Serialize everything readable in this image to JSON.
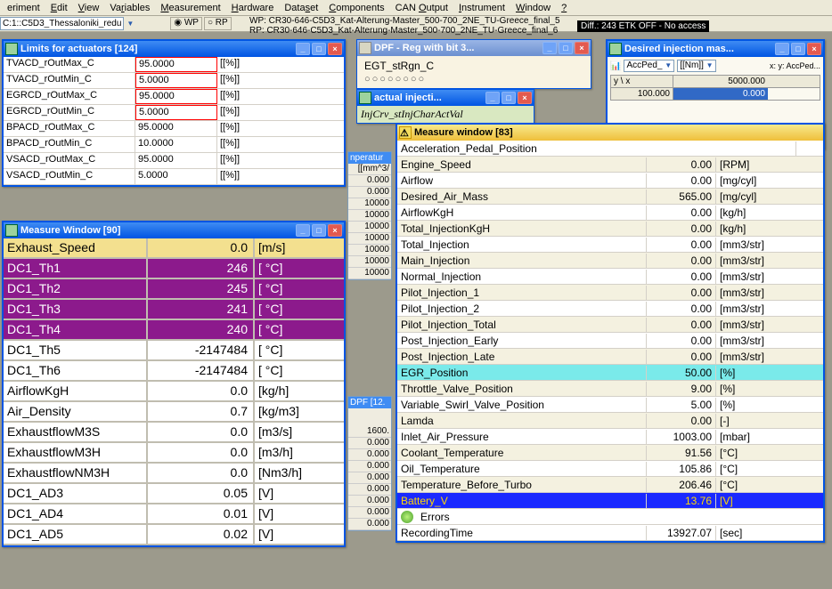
{
  "menu": {
    "items": [
      {
        "l": "eriment",
        "u": ""
      },
      {
        "l": "Edit",
        "u": "E"
      },
      {
        "l": "View",
        "u": "V"
      },
      {
        "l": "Variables",
        "u": "r"
      },
      {
        "l": "Measurement",
        "u": "M"
      },
      {
        "l": "Hardware",
        "u": "H"
      },
      {
        "l": "Dataset",
        "u": "s"
      },
      {
        "l": "Components",
        "u": "C"
      },
      {
        "l": "CAN Output",
        "u": "O"
      },
      {
        "l": "Instrument",
        "u": "I"
      },
      {
        "l": "Window",
        "u": "W"
      },
      {
        "l": "?",
        "u": "?"
      }
    ]
  },
  "tool": {
    "combo": "C:1::C5D3_Thessaloniki_redu",
    "wp": "WP",
    "rp": "RP",
    "wp_line": "WP: CR30-646-C5D3_Kat-Alterung-Master_500-700_2NE_TU-Greece_final_5",
    "rp_line": "RP: CR30-646-C5D3_Kat-Alterung-Master_500-700_2NE_TU-Greece_final_6",
    "diff": "Diff.: 243  ETK OFF - No access"
  },
  "limits": {
    "title": "Limits for actuators [124]",
    "rows": [
      {
        "n": "TVACD_rOutMax_C",
        "v": "95.0000",
        "u": "[[%]]",
        "r": true
      },
      {
        "n": "TVACD_rOutMin_C",
        "v": "5.0000",
        "u": "[[%]]",
        "r": true
      },
      {
        "n": "EGRCD_rOutMax_C",
        "v": "95.0000",
        "u": "[[%]]",
        "r": true
      },
      {
        "n": "EGRCD_rOutMin_C",
        "v": "5.0000",
        "u": "[[%]]",
        "r": true
      },
      {
        "n": "BPACD_rOutMax_C",
        "v": "95.0000",
        "u": "[[%]]",
        "r": false
      },
      {
        "n": "BPACD_rOutMin_C",
        "v": "10.0000",
        "u": "[[%]]",
        "r": false
      },
      {
        "n": "VSACD_rOutMax_C",
        "v": "95.0000",
        "u": "[[%]]",
        "r": false
      },
      {
        "n": "VSACD_rOutMin_C",
        "v": "5.0000",
        "u": "[[%]]",
        "r": false
      }
    ]
  },
  "m90": {
    "title": "Measure Window [90]",
    "rows": [
      {
        "n": "Exhaust_Speed",
        "v": "0.0",
        "u": "[m/s]",
        "cls": "y"
      },
      {
        "n": "DC1_Th1",
        "v": "246",
        "u": "[ °C]",
        "cls": "p"
      },
      {
        "n": "DC1_Th2",
        "v": "245",
        "u": "[ °C]",
        "cls": "p"
      },
      {
        "n": "DC1_Th3",
        "v": "241",
        "u": "[ °C]",
        "cls": "p"
      },
      {
        "n": "DC1_Th4",
        "v": "240",
        "u": "[ °C]",
        "cls": "p"
      },
      {
        "n": "DC1_Th5",
        "v": "-2147484",
        "u": "[ °C]",
        "cls": ""
      },
      {
        "n": "DC1_Th6",
        "v": "-2147484",
        "u": "[ °C]",
        "cls": ""
      },
      {
        "n": "AirflowKgH",
        "v": "0.0",
        "u": "[kg/h]",
        "cls": ""
      },
      {
        "n": "Air_Density",
        "v": "0.7",
        "u": "[kg/m3]",
        "cls": ""
      },
      {
        "n": "ExhaustflowM3S",
        "v": "0.0",
        "u": "[m3/s]",
        "cls": ""
      },
      {
        "n": "ExhaustflowM3H",
        "v": "0.0",
        "u": "[m3/h]",
        "cls": ""
      },
      {
        "n": "ExhaustflowNM3H",
        "v": "0.0",
        "u": "[Nm3/h]",
        "cls": ""
      },
      {
        "n": "DC1_AD3",
        "v": "0.05",
        "u": "[V]",
        "cls": ""
      },
      {
        "n": "DC1_AD4",
        "v": "0.01",
        "u": "[V]",
        "cls": ""
      },
      {
        "n": "DC1_AD5",
        "v": "0.02",
        "u": "[V]",
        "cls": ""
      }
    ]
  },
  "egt": {
    "title": "DPF - Reg with bit 3...",
    "name": "EGT_stRgn_C",
    "circles": "○○○○○○○○"
  },
  "ai": {
    "title": "actual injecti...",
    "name": "InjCrv_stInjCharActVal"
  },
  "di": {
    "title": "Desired injection mas...",
    "combo": "AccPed_",
    "unit": "[[Nm]]",
    "axes": "x:    y: AccPed...",
    "h1": "y \\ x",
    "h2": "5000.000",
    "r1": "100.000",
    "r2": "0.000"
  },
  "m83": {
    "title": "Measure window [83]",
    "rows": [
      {
        "n": "Acceleration_Pedal_Position",
        "v": "",
        "u": "",
        "cls": "head"
      },
      {
        "n": "Engine_Speed",
        "v": "0.00",
        "u": "[RPM]",
        "cls": "alt"
      },
      {
        "n": "Airflow",
        "v": "0.00",
        "u": "[mg/cyl]",
        "cls": ""
      },
      {
        "n": "Desired_Air_Mass",
        "v": "565.00",
        "u": "[mg/cyl]",
        "cls": "alt"
      },
      {
        "n": "AirflowKgH",
        "v": "0.00",
        "u": "[kg/h]",
        "cls": ""
      },
      {
        "n": "Total_InjectionKgH",
        "v": "0.00",
        "u": "[kg/h]",
        "cls": "alt"
      },
      {
        "n": "Total_Injection",
        "v": "0.00",
        "u": "[mm3/str]",
        "cls": ""
      },
      {
        "n": "Main_Injection",
        "v": "0.00",
        "u": "[mm3/str]",
        "cls": "alt"
      },
      {
        "n": "Normal_Injection",
        "v": "0.00",
        "u": "[mm3/str]",
        "cls": ""
      },
      {
        "n": "Pilot_Injection_1",
        "v": "0.00",
        "u": "[mm3/str]",
        "cls": "alt"
      },
      {
        "n": "Pilot_Injection_2",
        "v": "0.00",
        "u": "[mm3/str]",
        "cls": ""
      },
      {
        "n": "Pilot_Injection_Total",
        "v": "0.00",
        "u": "[mm3/str]",
        "cls": "alt"
      },
      {
        "n": "Post_Injection_Early",
        "v": "0.00",
        "u": "[mm3/str]",
        "cls": ""
      },
      {
        "n": "Post_Injection_Late",
        "v": "0.00",
        "u": "[mm3/str]",
        "cls": "alt"
      },
      {
        "n": "EGR_Position",
        "v": "50.00",
        "u": "[%]",
        "cls": "sel"
      },
      {
        "n": "Throttle_Valve_Position",
        "v": "9.00",
        "u": "[%]",
        "cls": "alt"
      },
      {
        "n": "Variable_Swirl_Valve_Position",
        "v": "5.00",
        "u": "[%]",
        "cls": ""
      },
      {
        "n": "Lamda",
        "v": "0.00",
        "u": "[-]",
        "cls": "alt"
      },
      {
        "n": "Inlet_Air_Pressure",
        "v": "1003.00",
        "u": "[mbar]",
        "cls": ""
      },
      {
        "n": "Coolant_Temperature",
        "v": "91.56",
        "u": "[°C]",
        "cls": "alt"
      },
      {
        "n": "Oil_Temperature",
        "v": "105.86",
        "u": "[°C]",
        "cls": ""
      },
      {
        "n": "Temperature_Before_Turbo",
        "v": "206.46",
        "u": "[°C]",
        "cls": "alt"
      },
      {
        "n": "Battery_V",
        "v": "13.76",
        "u": "[V]",
        "cls": "bsel"
      },
      {
        "n": "Errors",
        "v": "",
        "u": "",
        "cls": "errors"
      },
      {
        "n": "RecordingTime",
        "v": "13927.07",
        "u": "[sec]",
        "cls": ""
      }
    ]
  },
  "bg": {
    "unit": "[[mm^3/",
    "vals": [
      "0.000",
      "0.000",
      "10000",
      "10000",
      "10000",
      "10000",
      "10000",
      "10000",
      "10000"
    ],
    "dpf": "DPF [12.",
    "col": [
      "1600.",
      "0.000",
      "0.000",
      "0.000",
      "0.000",
      "0.000",
      "0.000",
      "0.000",
      "0.000"
    ]
  }
}
